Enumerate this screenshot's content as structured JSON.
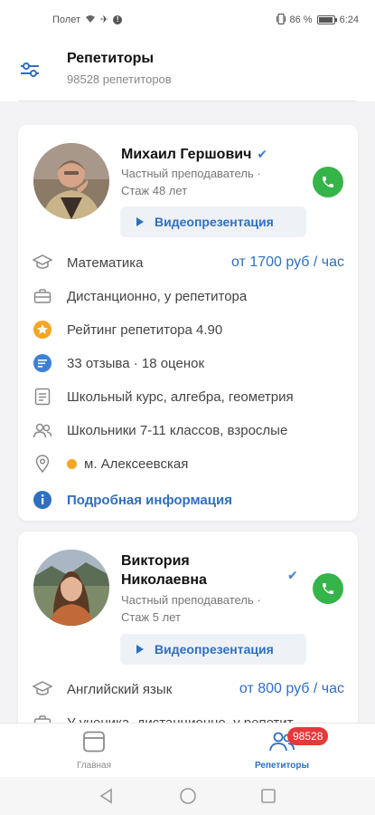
{
  "status_bar": {
    "carrier": "Полет",
    "battery_percent": "86 %",
    "time": "6:24"
  },
  "header": {
    "title": "Репетиторы",
    "subtitle": "98528 репетиторов"
  },
  "tutors": [
    {
      "name": "Михаил Гершович",
      "type": "Частный преподаватель ·",
      "experience": "Стаж 48 лет",
      "video_label": "Видеопрезентация",
      "subject": "Математика",
      "price": "от 1700 руб / час",
      "format": "Дистанционно, у репетитора",
      "rating": "Рейтинг репетитора 4.90",
      "reviews": "33 отзыва · 18 оценок",
      "topics": "Школьный курс, алгебра, геометрия",
      "students": "Школьники 7-11 классов, взрослые",
      "metro": "м. Алексеевская",
      "more": "Подробная информация"
    },
    {
      "name_line1": "Виктория",
      "name_line2": "Николаевна",
      "type": "Частный преподаватель ·",
      "experience": "Стаж 5 лет",
      "video_label": "Видеопрезентация",
      "subject": "Английский язык",
      "price": "от 800 руб / час",
      "format": "У ученика, дистанционно, у репетит"
    }
  ],
  "bottom_nav": {
    "home": "Главная",
    "tutors": "Репетиторы",
    "badge": "98528"
  },
  "colors": {
    "accent": "#2f6fbf",
    "call": "#35b44a",
    "star": "#f5a623",
    "badge": "#e53a3a"
  }
}
